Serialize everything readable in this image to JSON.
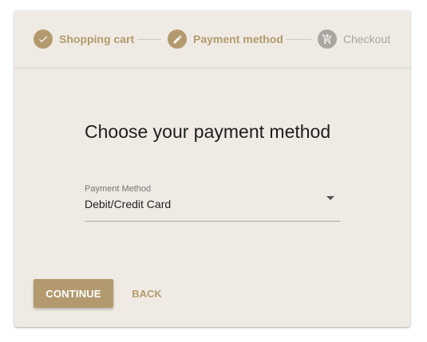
{
  "stepper": {
    "steps": [
      {
        "label": "Shopping cart",
        "state": "completed",
        "icon": "check-icon"
      },
      {
        "label": "Payment method",
        "state": "active-edit",
        "icon": "pencil-icon"
      },
      {
        "label": "Checkout",
        "state": "pending",
        "icon": "cart-icon"
      }
    ]
  },
  "main": {
    "title": "Choose your payment method",
    "payment_select": {
      "label": "Payment Method",
      "value": "Debit/Credit Card"
    }
  },
  "actions": {
    "continue_label": "CONTINUE",
    "back_label": "BACK"
  },
  "colors": {
    "accent": "#b39a6e",
    "card_background": "#efebe4",
    "inactive": "#a9a59f"
  }
}
